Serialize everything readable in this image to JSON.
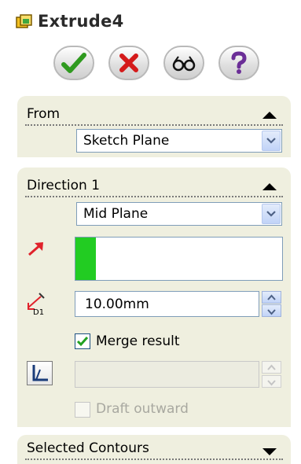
{
  "window": {
    "title": "Extrude4"
  },
  "actions": [
    {
      "name": "ok-button",
      "icon": "checkmark-icon"
    },
    {
      "name": "cancel-button",
      "icon": "x-icon"
    },
    {
      "name": "preview-button",
      "icon": "eyeglasses-icon"
    },
    {
      "name": "help-button",
      "icon": "question-icon"
    }
  ],
  "from": {
    "title": "From",
    "selected": "Sketch Plane"
  },
  "direction1": {
    "title": "Direction 1",
    "end_condition": "Mid Plane",
    "depth": "10.00mm",
    "merge_label": "Merge result",
    "merge_checked": true,
    "draft_outward_label": "Draft outward",
    "draft_outward_checked": false
  },
  "selected_contours": {
    "title": "Selected Contours"
  },
  "colors": {
    "direction_arrow": "#e0222b",
    "selection_swatch": "#22cc22",
    "panel_bg": "#efefdf",
    "ok_green": "#2f9a1f",
    "cancel_red": "#d41a1a",
    "help_purple": "#6b2e97"
  }
}
